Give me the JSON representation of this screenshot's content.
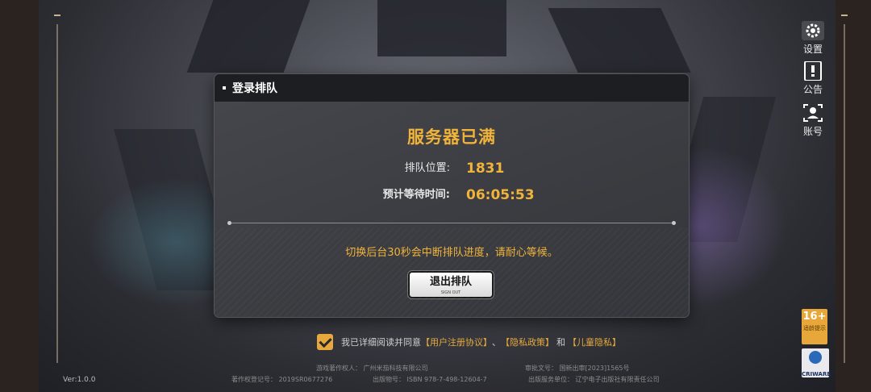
{
  "dialog": {
    "header_title": "登录排队",
    "heading": "服务器已满",
    "queue_position_label": "排队位置:",
    "queue_position_value": "1831",
    "wait_time_label": "预计等待时间:",
    "wait_time_value": "06:05:53",
    "notice": "切换后台30秒会中断排队进度，请耐心等候。",
    "exit_button_label": "退出排队",
    "exit_button_sub": "SIGN OUT"
  },
  "side_menu": {
    "settings_label": "设置",
    "notice_label": "公告",
    "account_label": "账号"
  },
  "agreement": {
    "prefix": "我已详细阅读并同意",
    "user_agreement": "【用户注册协议】",
    "sep1": "、",
    "privacy_policy": "【隐私政策】",
    "and": "和",
    "child_privacy": "【儿童隐私】"
  },
  "footer": {
    "copyright_holder": "游戏著作权人：  广州米茄科技有限公司",
    "approval_number": "审批文号：  国新出审[2023]1565号",
    "registration_number": "著作权登记号：  2019SR0677276",
    "publication_number": "出版物号：  ISBN 978-7-498-12604-7",
    "publisher": "出版服务单位：  辽宁电子出版社有限责任公司"
  },
  "version": "Ver:1.0.0",
  "age_badge": {
    "rating": "16+",
    "label": "适龄提示"
  },
  "criware_label": "CRIWARE",
  "colors": {
    "accent": "#f1b43a",
    "checkbox": "#e7a93b",
    "dialog_bg": "#3a3b40",
    "header_bg": "#1d1e22"
  }
}
